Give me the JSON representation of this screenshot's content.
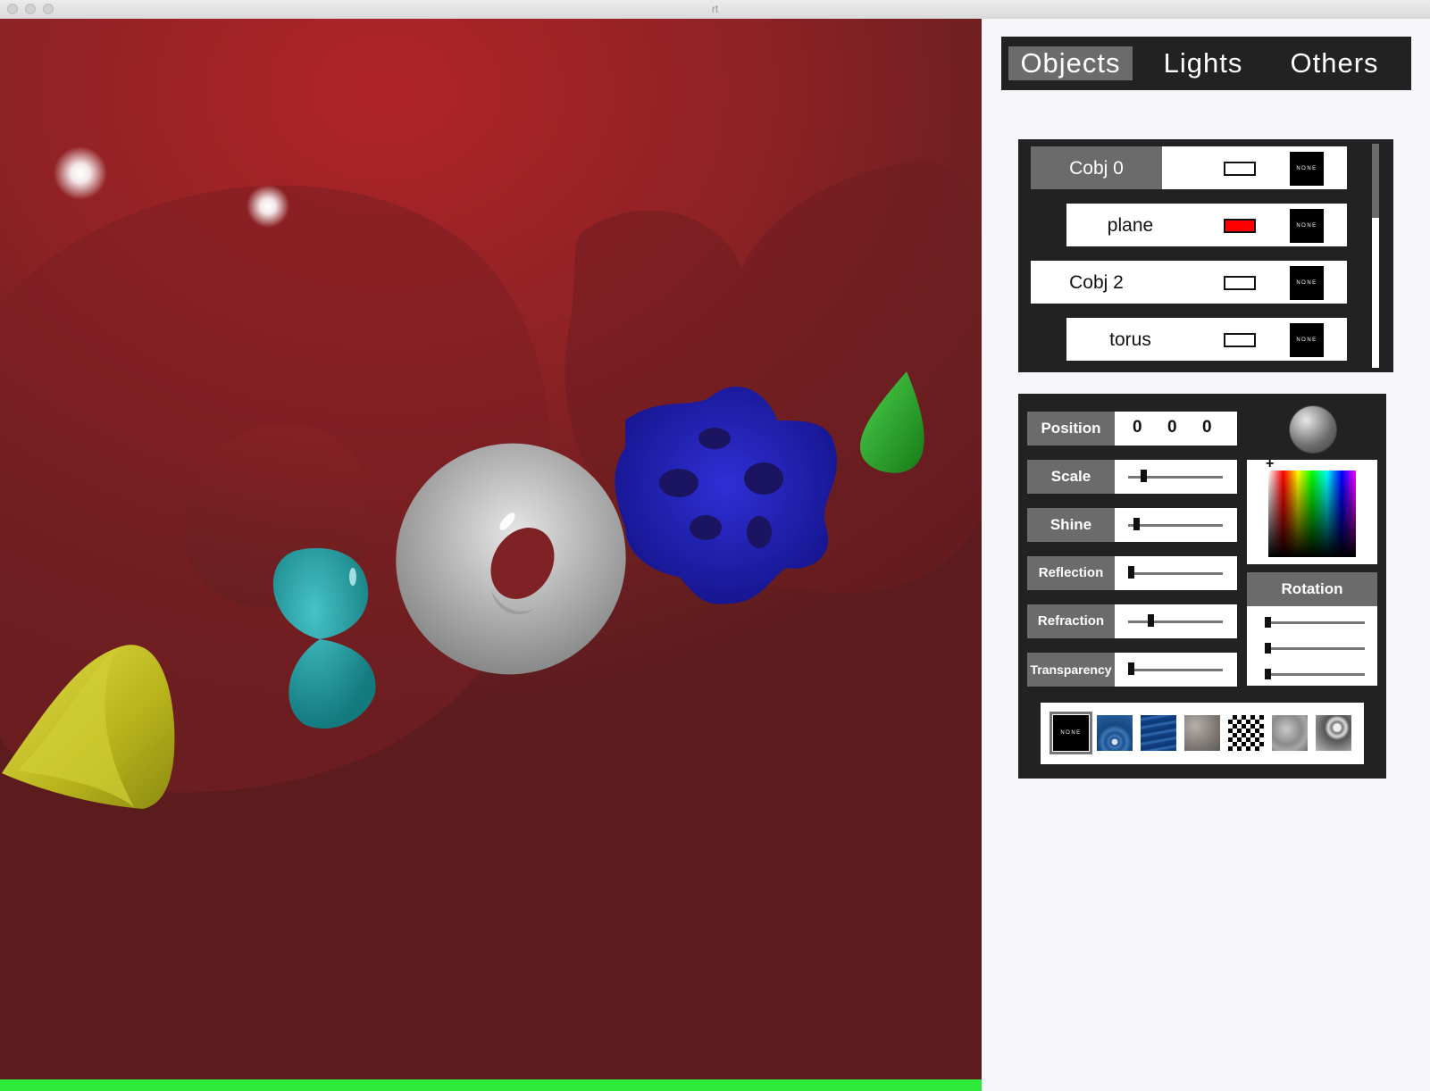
{
  "window": {
    "title": "rt"
  },
  "render": {
    "progress_fraction": 1.0,
    "progress_color": "#2ee83a"
  },
  "tabs": [
    {
      "label": "Objects",
      "active": true
    },
    {
      "label": "Lights",
      "active": false
    },
    {
      "label": "Others",
      "active": false
    }
  ],
  "objects": [
    {
      "name": "Cobj 0",
      "color": "#ffffff",
      "texture": "NONE",
      "selected": true,
      "child": false
    },
    {
      "name": "plane",
      "color": "#ff0000",
      "texture": "NONE",
      "selected": false,
      "child": true
    },
    {
      "name": "Cobj 2",
      "color": "#ffffff",
      "texture": "NONE",
      "selected": false,
      "child": false
    },
    {
      "name": "torus",
      "color": "#ffffff",
      "texture": "NONE",
      "selected": false,
      "child": true
    }
  ],
  "properties": {
    "position": {
      "label": "Position",
      "values": [
        "0",
        "0",
        "0"
      ]
    },
    "scale": {
      "label": "Scale",
      "value": 0.14
    },
    "shine": {
      "label": "Shine",
      "value": 0.06
    },
    "reflection": {
      "label": "Reflection",
      "value": 0.0
    },
    "refraction": {
      "label": "Refraction",
      "value": 0.22
    },
    "transparency": {
      "label": "Transparency",
      "value": 0.0
    }
  },
  "rotation": {
    "label": "Rotation",
    "values": [
      0.0,
      0.0,
      0.0
    ]
  },
  "textures": [
    {
      "name": "none-texture",
      "label": "NONE",
      "selected": true
    },
    {
      "name": "ripple-texture",
      "selected": false
    },
    {
      "name": "water-texture",
      "selected": false
    },
    {
      "name": "stone-texture",
      "selected": false
    },
    {
      "name": "checker-texture",
      "selected": false
    },
    {
      "name": "cloud-texture",
      "selected": false
    },
    {
      "name": "marble-texture",
      "selected": false
    }
  ]
}
